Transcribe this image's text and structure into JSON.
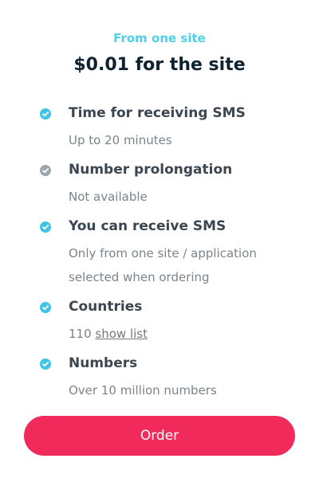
{
  "header": {
    "subtitle": "From one site",
    "title": "$0.01 for the site"
  },
  "features": [
    {
      "title": "Time for receiving SMS",
      "value": "Up to 20 minutes",
      "icon": "check-circle-icon",
      "enabled": true
    },
    {
      "title": "Number prolongation",
      "value": "Not available",
      "icon": "check-circle-icon",
      "enabled": false
    },
    {
      "title": "You can receive SMS",
      "value_lines": [
        "Only from one site / application",
        "selected when ordering"
      ],
      "icon": "check-circle-icon",
      "enabled": true
    },
    {
      "title": "Countries",
      "value": "110",
      "link": "show list",
      "icon": "check-circle-icon",
      "enabled": true
    },
    {
      "title": "Numbers",
      "value": "Over 10 million numbers",
      "icon": "check-circle-icon",
      "enabled": true
    }
  ],
  "order_button": {
    "label": "Order"
  },
  "colors": {
    "accent": "#4fcfe8",
    "check_enabled": "#3ec4e6",
    "check_disabled": "#9ca6ae",
    "button": "#f02b5b",
    "title": "#0f2230"
  }
}
